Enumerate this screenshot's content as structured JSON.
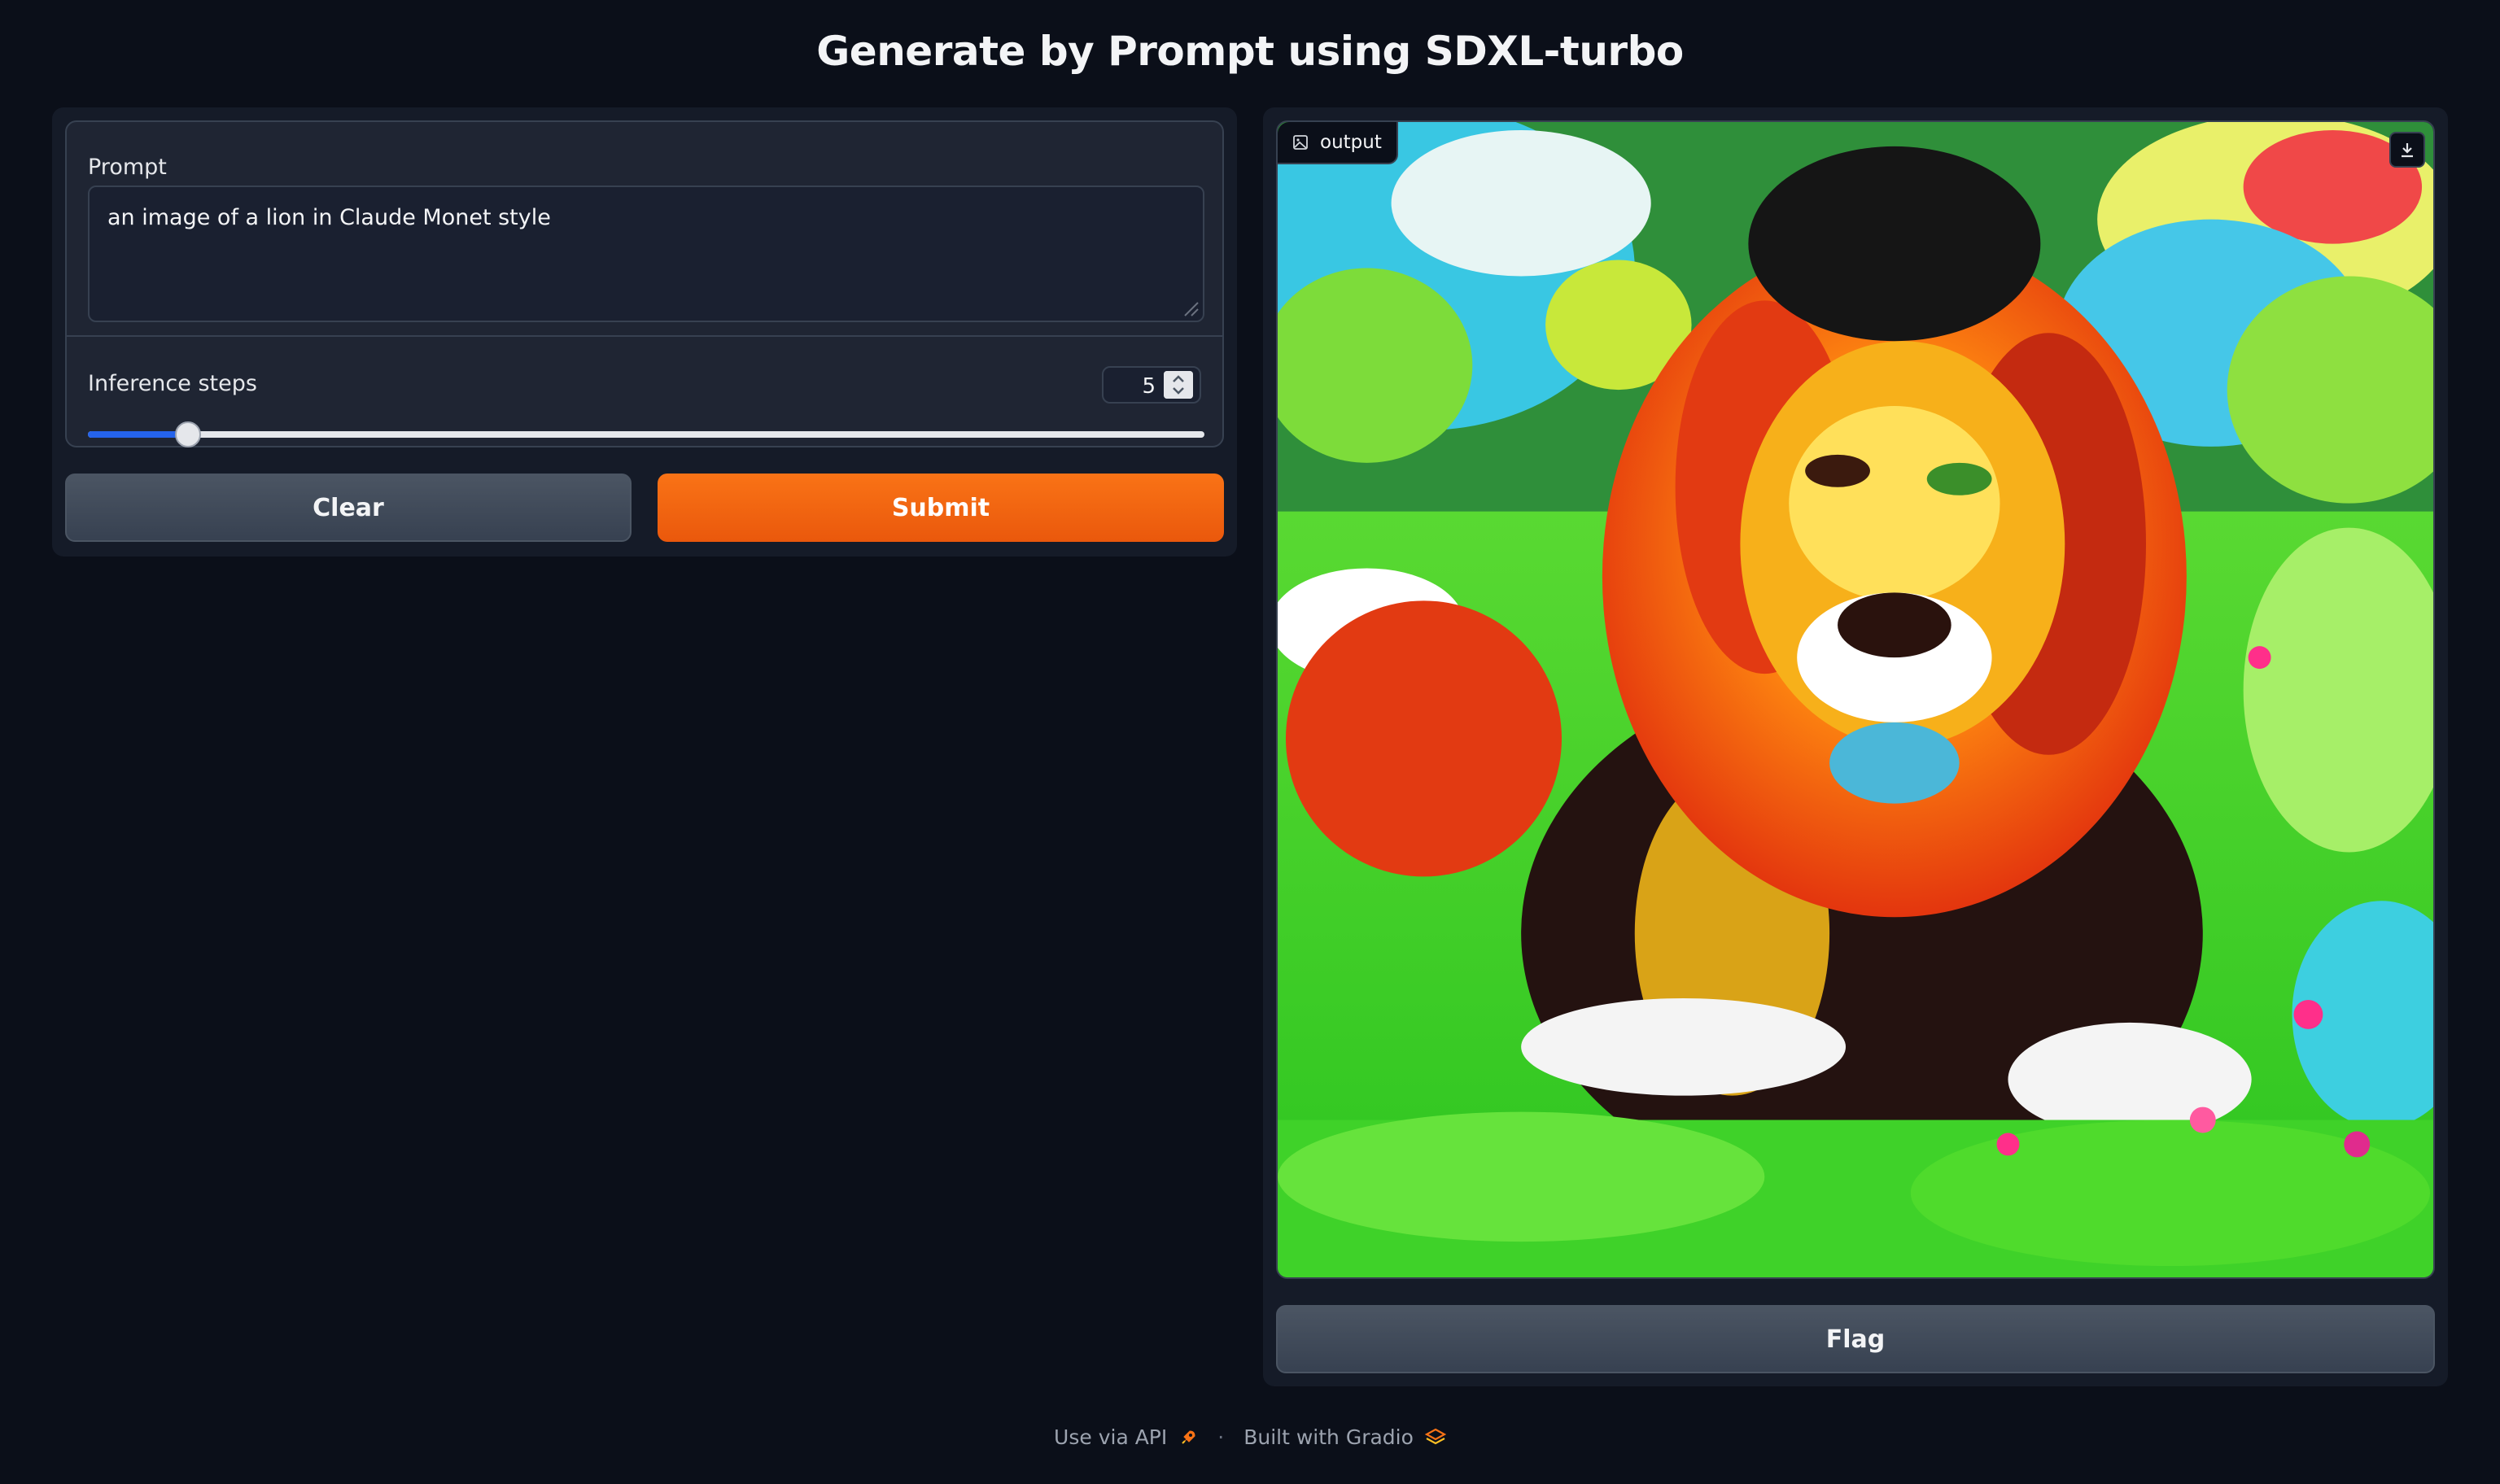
{
  "header": {
    "title": "Generate by Prompt using SDXL-turbo"
  },
  "prompt": {
    "label": "Prompt",
    "value": "an image of a lion in Claude Monet style"
  },
  "inference_steps": {
    "label": "Inference steps",
    "value": "5",
    "min": 1,
    "max": 50,
    "slider_fraction": 0.09
  },
  "buttons": {
    "clear": "Clear",
    "submit": "Submit",
    "flag": "Flag"
  },
  "output": {
    "label": "output",
    "image_description_icon": "image-icon",
    "download_icon": "download-icon"
  },
  "footer": {
    "api_link": "Use via API",
    "separator": "·",
    "built_with": "Built with Gradio",
    "api_icon": "rocket-icon",
    "gradio_icon": "gradio-logo-icon"
  },
  "colors": {
    "background": "#0b0f19",
    "panel": "#151b28",
    "accent_orange": "#f97316",
    "slider_blue": "#2563eb"
  }
}
